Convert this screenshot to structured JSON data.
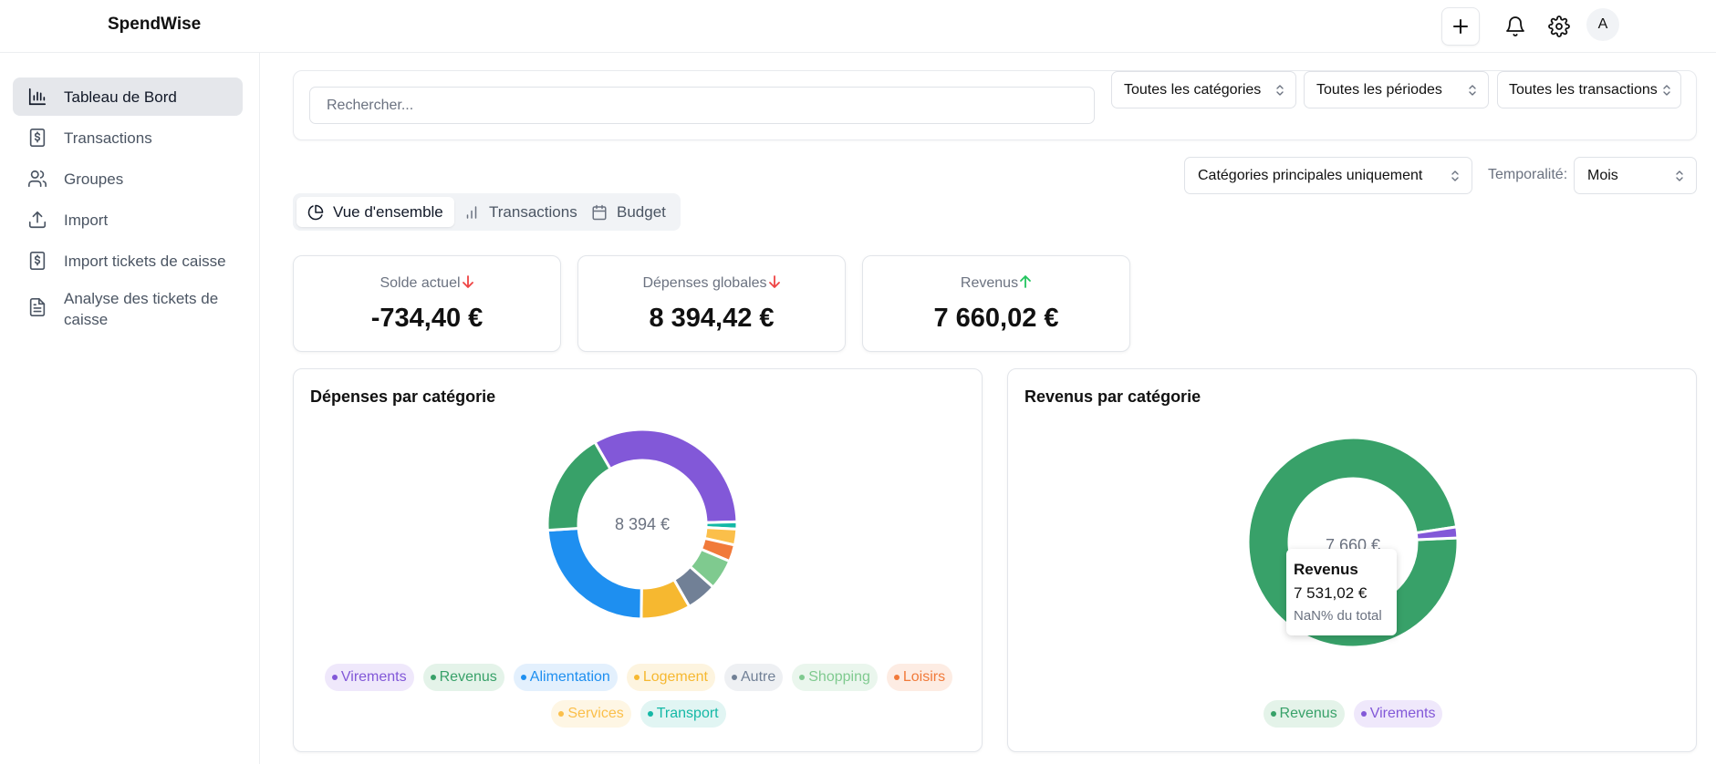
{
  "app": {
    "brand": "SpendWise",
    "avatar_initial": "A"
  },
  "header": {
    "icons": [
      "plus-icon",
      "bell-icon",
      "gear-icon"
    ]
  },
  "sidebar": {
    "items": [
      {
        "label": "Tableau de Bord",
        "icon": "bar-chart-icon",
        "active": true
      },
      {
        "label": "Transactions",
        "icon": "dollar-doc-icon",
        "active": false
      },
      {
        "label": "Groupes",
        "icon": "users-icon",
        "active": false
      },
      {
        "label": "Import",
        "icon": "upload-icon",
        "active": false
      },
      {
        "label": "Import tickets de caisse",
        "icon": "dollar-doc-icon",
        "active": false
      },
      {
        "label": "Analyse des tickets de caisse",
        "icon": "file-icon",
        "active": false
      }
    ]
  },
  "filters": {
    "search_placeholder": "Rechercher...",
    "category": "Toutes les catégories",
    "period": "Toutes les périodes",
    "transactions": "Toutes les transactions"
  },
  "options": {
    "category_scope": "Catégories principales uniquement",
    "temporality_label": "Temporalité:",
    "temporality_value": "Mois"
  },
  "tabs": [
    {
      "label": "Vue d'ensemble",
      "icon": "pie-chart-icon",
      "active": true
    },
    {
      "label": "Transactions",
      "icon": "bar-chart-icon",
      "active": false
    },
    {
      "label": "Budget",
      "icon": "calendar-icon",
      "active": false
    }
  ],
  "stats": [
    {
      "title": "Solde actuel",
      "value": "-734,40 €",
      "trend": "down",
      "trend_color": "#ef4444"
    },
    {
      "title": "Dépenses globales",
      "value": "8 394,42 €",
      "trend": "down",
      "trend_color": "#ef4444"
    },
    {
      "title": "Revenus",
      "value": "7 660,02 €",
      "trend": "up",
      "trend_color": "#22c55e"
    }
  ],
  "expenses_chart": {
    "title": "Dépenses par catégorie",
    "center_label": "8 394 €",
    "legend": [
      {
        "name": "Virements",
        "color": "#8258d8",
        "bg": "#efe8fb"
      },
      {
        "name": "Revenus",
        "color": "#38a169",
        "bg": "#e4f3e9"
      },
      {
        "name": "Alimentation",
        "color": "#1e8ff0",
        "bg": "#e3f0fd"
      },
      {
        "name": "Logement",
        "color": "#f6b830",
        "bg": "#fdf4df"
      },
      {
        "name": "Autre",
        "color": "#718096",
        "bg": "#eef0f3"
      },
      {
        "name": "Shopping",
        "color": "#7fca8f",
        "bg": "#eaf6ed"
      },
      {
        "name": "Loisirs",
        "color": "#f17a3a",
        "bg": "#fdece3"
      },
      {
        "name": "Services",
        "color": "#fbbf4a",
        "bg": "#fef6e4"
      },
      {
        "name": "Transport",
        "color": "#14b8a6",
        "bg": "#e1f5f3"
      }
    ]
  },
  "income_chart": {
    "title": "Revenus par catégorie",
    "center_label": "7 660 €",
    "legend": [
      {
        "name": "Revenus",
        "color": "#38a169",
        "bg": "#e4f3e9"
      },
      {
        "name": "Virements",
        "color": "#8258d8",
        "bg": "#efe8fb"
      }
    ],
    "tooltip": {
      "title": "Revenus",
      "value": "7 531,02 €",
      "share": "NaN% du total"
    }
  },
  "chart_data": [
    {
      "type": "pie",
      "title": "Dépenses par catégorie",
      "center_total": "8 394 €",
      "categories": [
        "Virements",
        "Transport",
        "Services",
        "Loisirs",
        "Shopping",
        "Autre",
        "Logement",
        "Alimentation",
        "Revenus"
      ],
      "values": [
        2420,
        90,
        200,
        210,
        380,
        380,
        620,
        1750,
        1300
      ],
      "colors": [
        "#8258d8",
        "#14b8a6",
        "#fbbf4a",
        "#f17a3a",
        "#7fca8f",
        "#718096",
        "#f6b830",
        "#1e8ff0",
        "#38a169"
      ]
    },
    {
      "type": "pie",
      "title": "Revenus par catégorie",
      "center_total": "7 660 €",
      "categories": [
        "Revenus",
        "Virements"
      ],
      "values": [
        7531.02,
        129
      ],
      "colors": [
        "#38a169",
        "#8258d8"
      ]
    }
  ]
}
